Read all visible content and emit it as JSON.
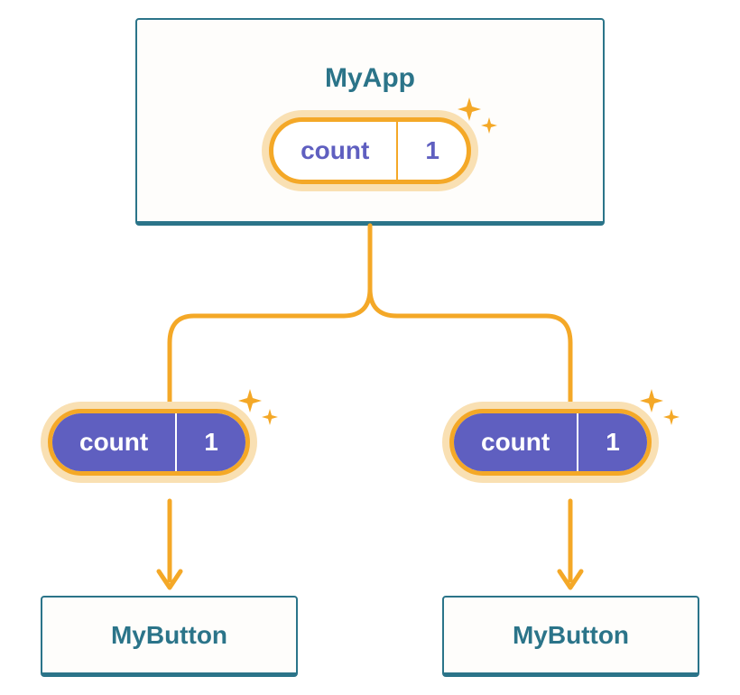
{
  "parent": {
    "title": "MyApp",
    "state_label": "count",
    "state_value": "1"
  },
  "children": [
    {
      "prop_label": "count",
      "prop_value": "1",
      "component_name": "MyButton"
    },
    {
      "prop_label": "count",
      "prop_value": "1",
      "component_name": "MyButton"
    }
  ],
  "colors": {
    "teal": "#2b7489",
    "purple": "#5f5fc0",
    "orange": "#f4a827",
    "orange_light": "#f9e0b3"
  }
}
